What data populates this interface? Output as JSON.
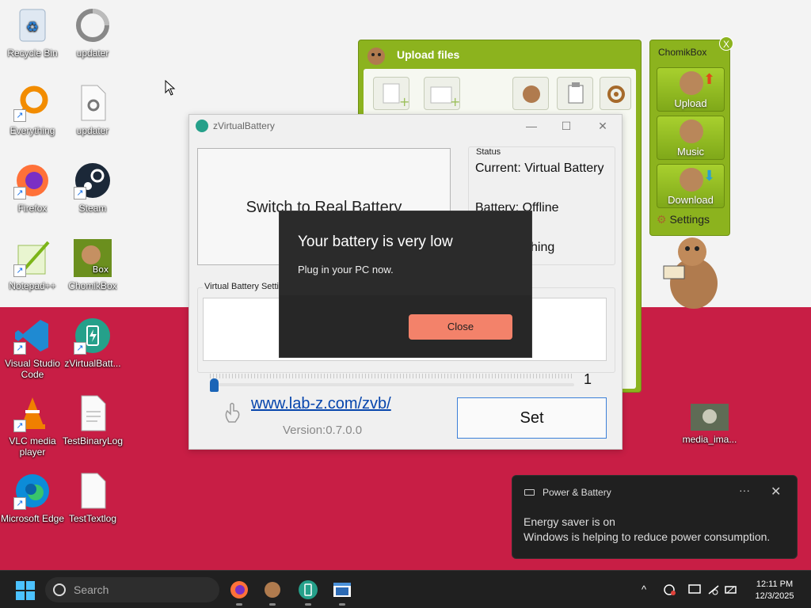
{
  "desktop": {
    "icons": [
      {
        "label": "Recycle Bin"
      },
      {
        "label": "updater"
      },
      {
        "label": "Everything"
      },
      {
        "label": "updater"
      },
      {
        "label": "Firefox"
      },
      {
        "label": "Steam"
      },
      {
        "label": "Notepad++"
      },
      {
        "label": "ChomikBox"
      },
      {
        "label": "Visual Studio Code"
      },
      {
        "label": "zVirtualBatt..."
      },
      {
        "label": "VLC media player"
      },
      {
        "label": "TestBinaryLog"
      },
      {
        "label": "Microsoft Edge"
      },
      {
        "label": "TestTextlog"
      },
      {
        "label": "media_ima..."
      }
    ]
  },
  "chomik_upload": {
    "title": "Upload files"
  },
  "chomik_panel": {
    "title": "ChomikBox",
    "close": "X",
    "upload": "Upload",
    "music": "Music",
    "download": "Download",
    "settings": "Settings"
  },
  "zvb": {
    "title": "zVirtualBattery",
    "minimize": "—",
    "maximize": "☐",
    "close": "✕",
    "switch_button": "Switch to Real Battery",
    "status_caption": "Status",
    "status_current": "Current: Virtual Battery",
    "status_battery": "Battery: Offline",
    "status_third": "hing",
    "vb_settings_caption": "Virtual Battery Settin",
    "slider_value": "1",
    "slider_level": 0,
    "link": "www.lab-z.com/zvb/",
    "version": "Version:0.7.0.0",
    "set_button": "Set"
  },
  "dialog": {
    "title": "Your battery is very low",
    "message": "Plug in your PC now.",
    "close_button": "Close"
  },
  "toast": {
    "app": "Power & Battery",
    "more": "···",
    "close": "✕",
    "line1": "Energy saver is on",
    "line2": "Windows is helping to reduce power consumption."
  },
  "taskbar": {
    "search_placeholder": "Search",
    "time": "12:11 PM",
    "date": "12/3/2025",
    "chevron": "^"
  },
  "colors": {
    "desktop_bottom": "#c81e45",
    "chomik_green": "#8cb31e",
    "dialog_button": "#f3826a",
    "link": "#0645ad",
    "taskbar": "#202020"
  }
}
